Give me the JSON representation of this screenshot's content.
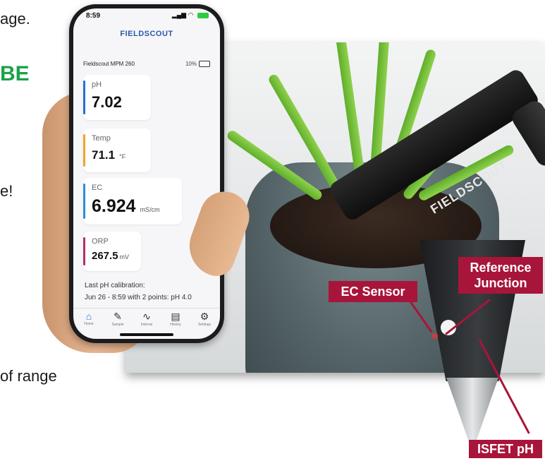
{
  "background_text": {
    "line1": "age.",
    "heading": "BE",
    "line2": "e!",
    "line3": "of range"
  },
  "phone": {
    "status": {
      "time": "8:59"
    },
    "brand": "FIELDSCOUT",
    "device": {
      "name": "Fieldscout MPM 260",
      "battery": "10%"
    },
    "readings": [
      {
        "label": "pH",
        "value": "7.02",
        "unit": "",
        "color": "#2a6fd6"
      },
      {
        "label": "Temp",
        "value": "71.1",
        "unit": "°F",
        "color": "#f0a22e"
      },
      {
        "label": "EC",
        "value": "6.924",
        "unit": "mS/cm",
        "color": "#2c8ed6"
      },
      {
        "label": "ORP",
        "value": "267.5",
        "unit": "mV",
        "color": "#b0306a"
      }
    ],
    "calibration": {
      "title": "Last pH calibration:",
      "detail": "Jun 26 - 8:59 with 2 points: pH 4.0"
    },
    "tabs": [
      {
        "label": "Home",
        "icon": "home-icon",
        "glyph": "⌂"
      },
      {
        "label": "Sample",
        "icon": "probe-icon",
        "glyph": "✎"
      },
      {
        "label": "Interval",
        "icon": "chart-line-icon",
        "glyph": "∿"
      },
      {
        "label": "History",
        "icon": "history-icon",
        "glyph": "▤"
      },
      {
        "label": "Settings",
        "icon": "gear-icon",
        "glyph": "⚙"
      }
    ]
  },
  "probe": {
    "logo": "FIELDSCOUT"
  },
  "callouts": {
    "ec_sensor": "EC Sensor",
    "reference_junction_line1": "Reference",
    "reference_junction_line2": "Junction",
    "isfet": "ISFET pH"
  },
  "colors": {
    "callout": "#a8153a",
    "heading_green": "#1aa34a"
  }
}
